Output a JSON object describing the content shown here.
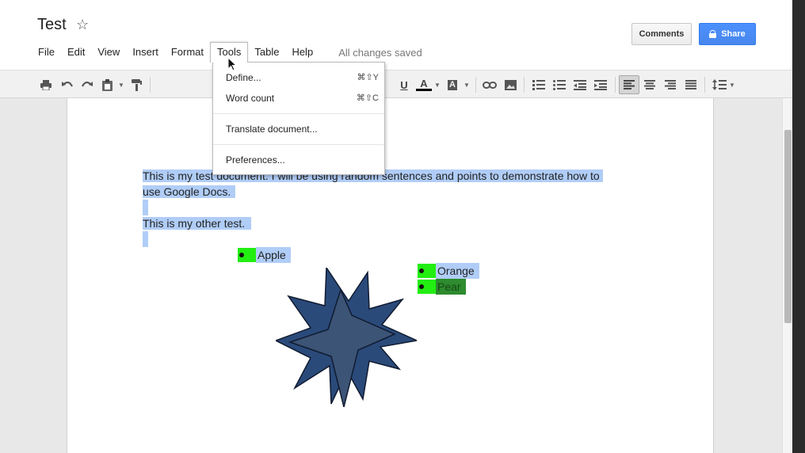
{
  "doc": {
    "title": "Test",
    "saved_status": "All changes saved"
  },
  "menu": [
    "File",
    "Edit",
    "View",
    "Insert",
    "Format",
    "Tools",
    "Table",
    "Help"
  ],
  "buttons": {
    "comments": "Comments",
    "share": "Share"
  },
  "toolbar": {
    "text_color_letter": "A",
    "highlight_letter": "A",
    "underline_letter": "U"
  },
  "tools_menu": {
    "define": {
      "label": "Define...",
      "shortcut": "⌘⇧Y"
    },
    "word_count": {
      "label": "Word count",
      "shortcut": "⌘⇧C"
    },
    "translate": {
      "label": "Translate document..."
    },
    "preferences": {
      "label": "Preferences..."
    }
  },
  "content": {
    "para1_line1": "This is my test document. I will be using random sentences and points to demonstrate how to",
    "para1_line2": "use Google Docs.",
    "para2": "This is my other test.",
    "bullets": [
      "Apple",
      "Orange",
      "Pear"
    ]
  },
  "colors": {
    "accent": "#4d90fe",
    "selection": "#b0cdf7",
    "bullet_highlight": "#22ee11",
    "star": "#2c4670"
  }
}
